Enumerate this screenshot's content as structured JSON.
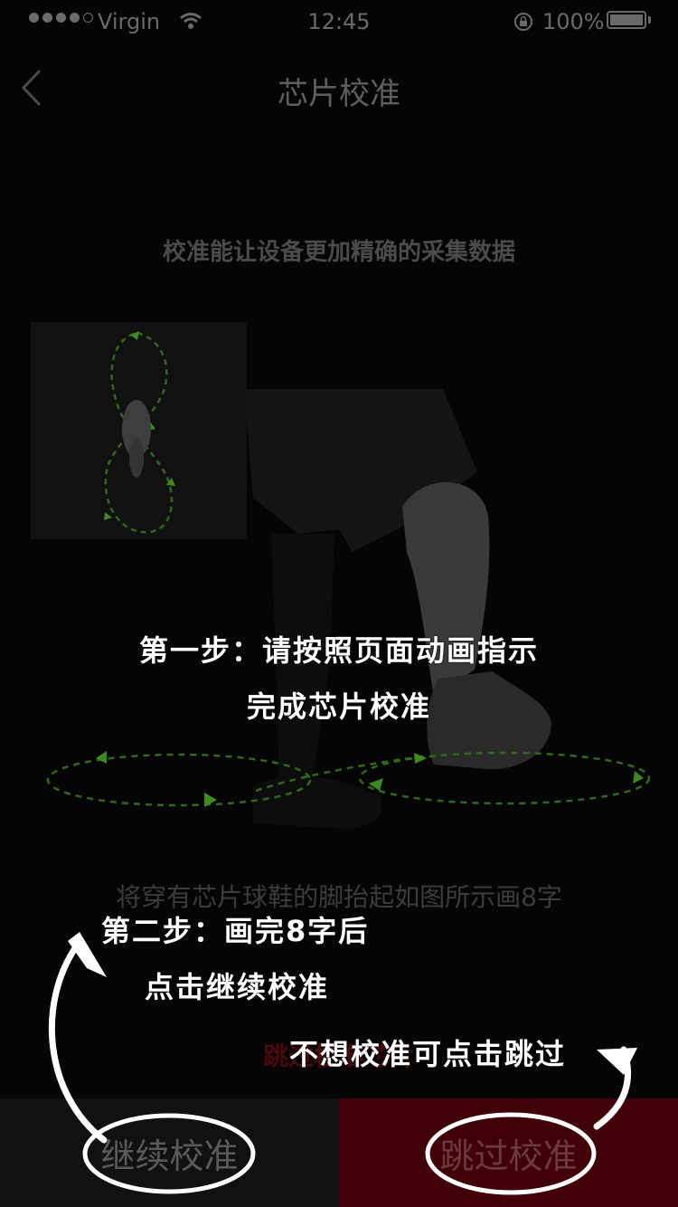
{
  "status_bar": {
    "carrier": "Virgin",
    "time": "12:45",
    "battery": "100%"
  },
  "nav": {
    "title": "芯片校准"
  },
  "main": {
    "subtitle": "校准能让设备更加精确的采集数据",
    "instruction": "将穿有芯片球鞋的脚抬起如图所示画8字",
    "skip_note": "跳过校准芯片"
  },
  "buttons": {
    "continue_label": "继续校准",
    "skip_label": "跳过校准"
  },
  "annotations": {
    "step1_line1": "第一步：请按照页面动画指示",
    "step1_line2": "完成芯片校准",
    "step2_line1": "第二步：画完8字后",
    "step2_line2": "点击继续校准",
    "skip_hint": "不想校准可点击跳过"
  },
  "colors": {
    "continue_bg": "#111111",
    "skip_bg": "#410006",
    "path_green": "#3d8a1f"
  }
}
